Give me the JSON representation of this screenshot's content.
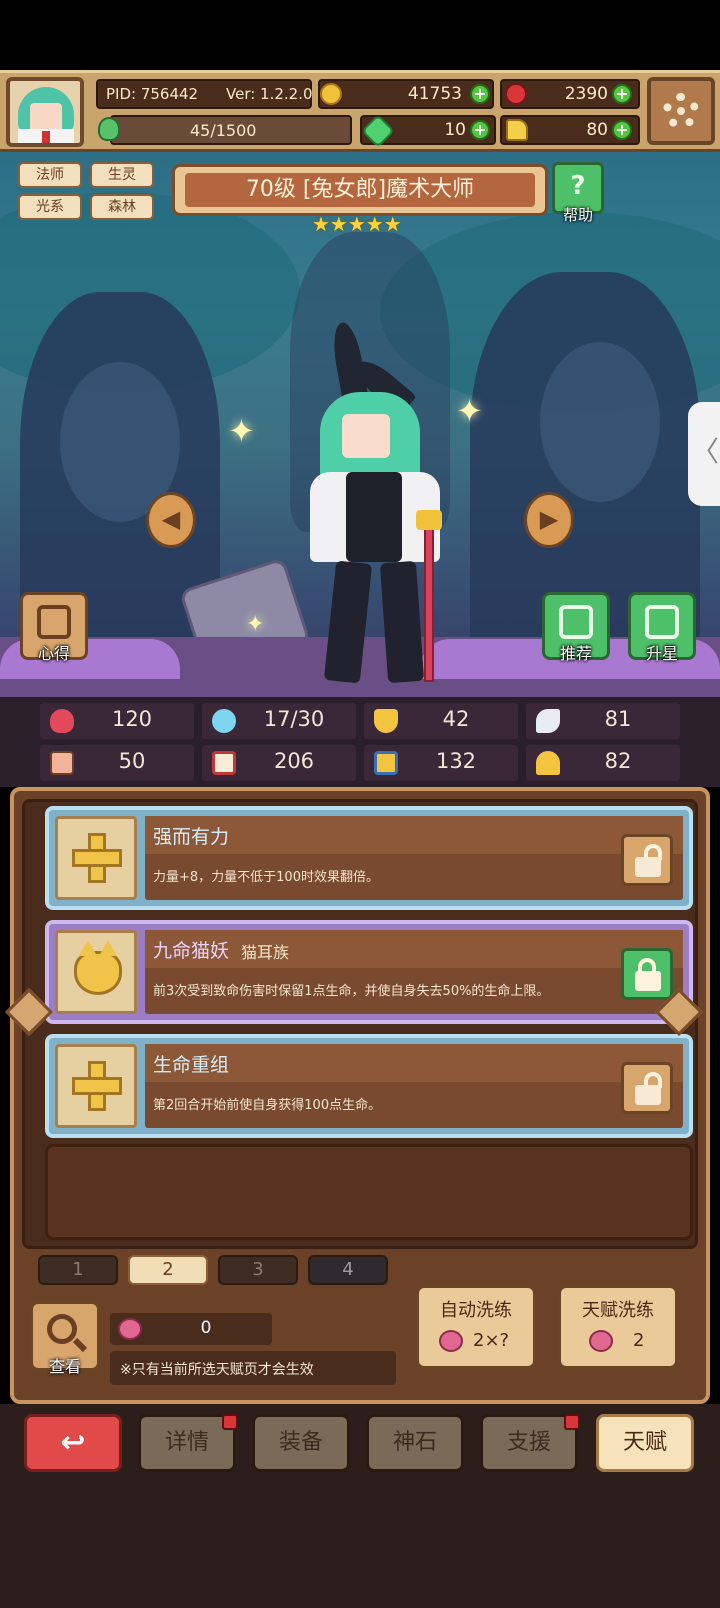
{
  "header": {
    "pid": "PID: 756442",
    "version": "Ver: 1.2.2.0",
    "gold": "41753",
    "gems": "2390",
    "stamina": "45/1500",
    "clover": "10",
    "pointer": "80"
  },
  "hero": {
    "tags": [
      "法师",
      "生灵",
      "光系",
      "森林"
    ],
    "title": "70级 [兔女郎]魔术大师",
    "stars": "★★★★★",
    "help_label": "帮助",
    "left_button_label": "心得",
    "recommend_label": "推荐",
    "upgrade_star_label": "升星"
  },
  "stats": [
    {
      "icon": "heart-icon",
      "value": "120"
    },
    {
      "icon": "mana-drop-icon",
      "value": "17/30"
    },
    {
      "icon": "shield-icon",
      "value": "42"
    },
    {
      "icon": "wing-icon",
      "value": "81"
    },
    {
      "icon": "fist-icon",
      "value": "50"
    },
    {
      "icon": "book-icon",
      "value": "206"
    },
    {
      "icon": "boot-icon",
      "value": "132"
    },
    {
      "icon": "horseshoe-icon",
      "value": "82"
    }
  ],
  "talents": [
    {
      "name": "强而有力",
      "tag": "",
      "desc": "力量+8，力量不低于100时效果翻倍。",
      "locked": false
    },
    {
      "name": "九命猫妖",
      "tag": "猫耳族",
      "desc": "前3次受到致命伤害时保留1点生命，并使自身失去50%的生命上限。",
      "locked": true
    },
    {
      "name": "生命重组",
      "tag": "",
      "desc": "第2回合开始前使自身获得100点生命。",
      "locked": false
    }
  ],
  "pages": [
    "1",
    "2",
    "3",
    "4"
  ],
  "controls": {
    "view_label": "查看",
    "cost_value": "0",
    "note": "※只有当前所选天赋页才会生效",
    "auto_wash_label": "自动洗练",
    "auto_wash_cost": "2×?",
    "talent_wash_label": "天赋洗练",
    "talent_wash_cost": "2"
  },
  "nav": {
    "details": "详情",
    "equip": "装备",
    "stone": "神石",
    "support": "支援",
    "talent": "天赋"
  },
  "colors": {
    "accent_green": "#4fc06a",
    "accent_brown": "#6b4128",
    "nav_active": "#f6e3bb"
  }
}
